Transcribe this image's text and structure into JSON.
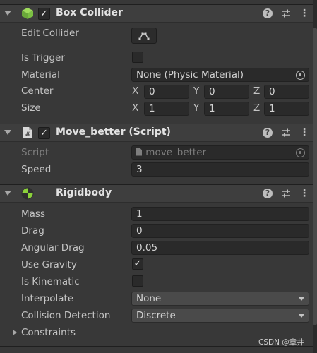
{
  "box_collider": {
    "title": "Box Collider",
    "enabled": "✓",
    "edit_collider_label": "Edit Collider",
    "is_trigger_label": "Is Trigger",
    "material_label": "Material",
    "material_value": "None (Physic Material)",
    "center_label": "Center",
    "center": {
      "x": "0",
      "y": "0",
      "z": "0"
    },
    "size_label": "Size",
    "size": {
      "x": "1",
      "y": "1",
      "z": "1"
    },
    "axis": {
      "x": "X",
      "y": "Y",
      "z": "Z"
    }
  },
  "move_script": {
    "title": "Move_better (Script)",
    "enabled": "✓",
    "script_label": "Script",
    "script_value": "move_better",
    "speed_label": "Speed",
    "speed_value": "3"
  },
  "rigidbody": {
    "title": "Rigidbody",
    "mass_label": "Mass",
    "mass_value": "1",
    "drag_label": "Drag",
    "drag_value": "0",
    "angular_drag_label": "Angular Drag",
    "angular_drag_value": "0.05",
    "use_gravity_label": "Use Gravity",
    "use_gravity_check": "✓",
    "is_kinematic_label": "Is Kinematic",
    "interpolate_label": "Interpolate",
    "interpolate_value": "None",
    "collision_detection_label": "Collision Detection",
    "collision_detection_value": "Discrete",
    "constraints_label": "Constraints"
  },
  "header_buttons": {
    "help": "?",
    "menu": "⋮"
  },
  "watermark": "CSDN @章井",
  "colors": {
    "background": "#383838",
    "header": "#3e3e3e",
    "field": "#2a2a2a",
    "box_icon": "#7bc043",
    "rigidbody_icon": "#8bd13b"
  }
}
